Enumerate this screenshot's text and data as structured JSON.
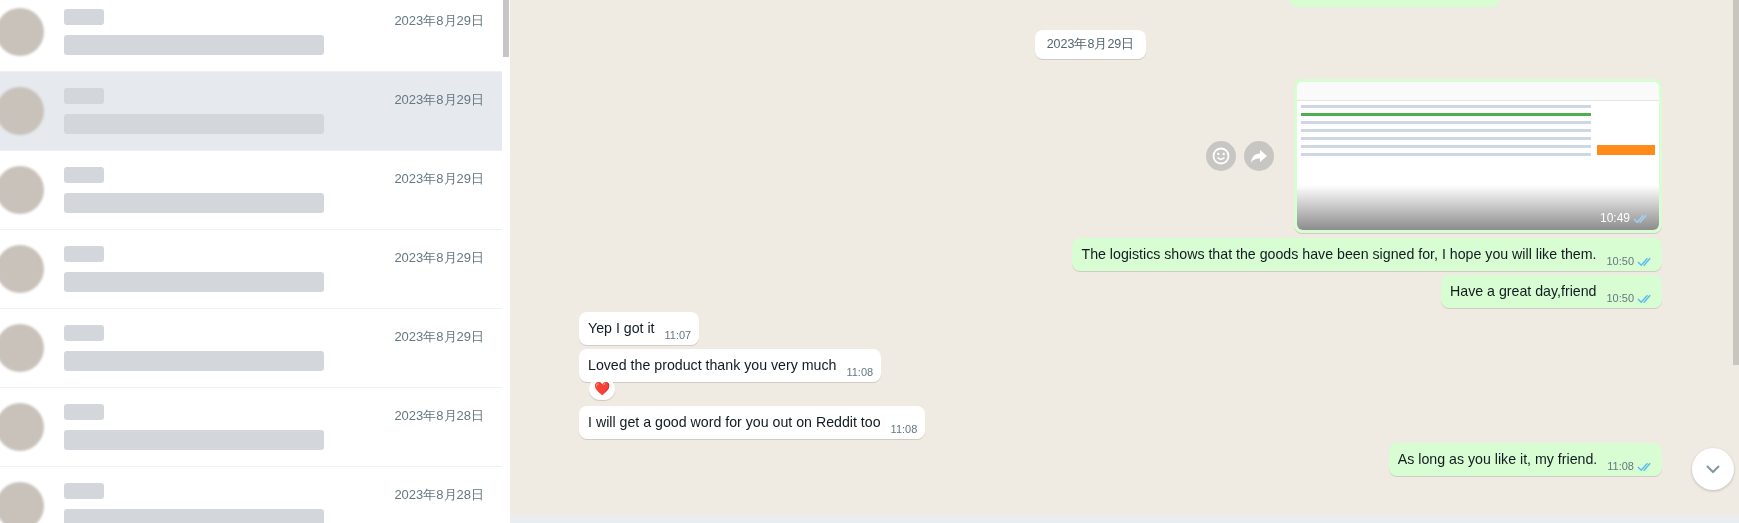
{
  "chat_list": {
    "items": [
      {
        "date": "2023年8月29日",
        "selected": false,
        "hovered": false
      },
      {
        "date": "2023年8月29日",
        "selected": true,
        "hovered": false
      },
      {
        "date": "2023年8月29日",
        "selected": false,
        "hovered": false
      },
      {
        "date": "2023年8月29日",
        "selected": false,
        "hovered": false
      },
      {
        "date": "2023年8月29日",
        "selected": false,
        "hovered": false
      },
      {
        "date": "2023年8月28日",
        "selected": false,
        "hovered": false
      },
      {
        "date": "2023年8月28日",
        "selected": false,
        "hovered": false
      }
    ]
  },
  "conversation": {
    "date_divider": "2023年8月29日",
    "messages": [
      {
        "kind": "image",
        "outgoing": true,
        "time": "10:49",
        "read": true
      },
      {
        "kind": "text",
        "outgoing": true,
        "text": "The logistics shows that the goods have been signed for, I hope you will like them.",
        "time": "10:50",
        "read": true
      },
      {
        "kind": "text",
        "outgoing": true,
        "text": "Have a great day,friend",
        "time": "10:50",
        "read": true
      },
      {
        "kind": "text",
        "outgoing": false,
        "text": "Yep I got it",
        "time": "11:07"
      },
      {
        "kind": "text",
        "outgoing": false,
        "text": "Loved the product thank you very much",
        "time": "11:08",
        "reaction": "❤️"
      },
      {
        "kind": "text",
        "outgoing": false,
        "text": "I will get a good word for you out on Reddit too",
        "time": "11:08"
      },
      {
        "kind": "text",
        "outgoing": true,
        "text": "As long as you like it, my friend.",
        "time": "11:08",
        "read": true
      }
    ]
  }
}
